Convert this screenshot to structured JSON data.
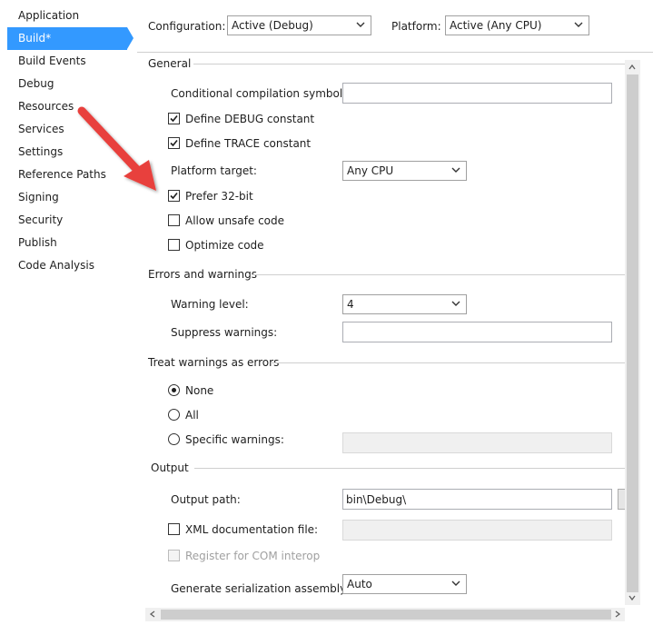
{
  "sidebar": {
    "items": [
      {
        "label": "Application"
      },
      {
        "label": "Build*"
      },
      {
        "label": "Build Events"
      },
      {
        "label": "Debug"
      },
      {
        "label": "Resources"
      },
      {
        "label": "Services"
      },
      {
        "label": "Settings"
      },
      {
        "label": "Reference Paths"
      },
      {
        "label": "Signing"
      },
      {
        "label": "Security"
      },
      {
        "label": "Publish"
      },
      {
        "label": "Code Analysis"
      }
    ],
    "active_index": 1
  },
  "toolbar": {
    "configuration_label": "Configuration:",
    "configuration_value": "Active (Debug)",
    "platform_label": "Platform:",
    "platform_value": "Active (Any CPU)"
  },
  "general": {
    "heading": "General",
    "conditional_symbols_label": "Conditional compilation symbols:",
    "conditional_symbols_value": "",
    "define_debug_label": "Define DEBUG constant",
    "define_debug_checked": true,
    "define_trace_label": "Define TRACE constant",
    "define_trace_checked": true,
    "platform_target_label": "Platform target:",
    "platform_target_value": "Any CPU",
    "prefer32_label": "Prefer 32-bit",
    "prefer32_checked": true,
    "unsafe_label": "Allow unsafe code",
    "unsafe_checked": false,
    "optimize_label": "Optimize code",
    "optimize_checked": false
  },
  "errors": {
    "heading": "Errors and warnings",
    "warning_level_label": "Warning level:",
    "warning_level_value": "4",
    "suppress_label": "Suppress warnings:",
    "suppress_value": ""
  },
  "treat": {
    "heading": "Treat warnings as errors",
    "none_label": "None",
    "all_label": "All",
    "specific_label": "Specific warnings:",
    "selected": "none",
    "specific_value": ""
  },
  "output": {
    "heading": "Output",
    "path_label": "Output path:",
    "path_value": "bin\\Debug\\",
    "xmldoc_label": "XML documentation file:",
    "xmldoc_checked": false,
    "xmldoc_value": "",
    "com_label": "Register for COM interop",
    "com_checked": false,
    "serialization_label": "Generate serialization assembly:",
    "serialization_value": "Auto"
  },
  "annotation": {
    "arrow_color": "#e8413c"
  },
  "colors": {
    "accent": "#3399ff"
  }
}
